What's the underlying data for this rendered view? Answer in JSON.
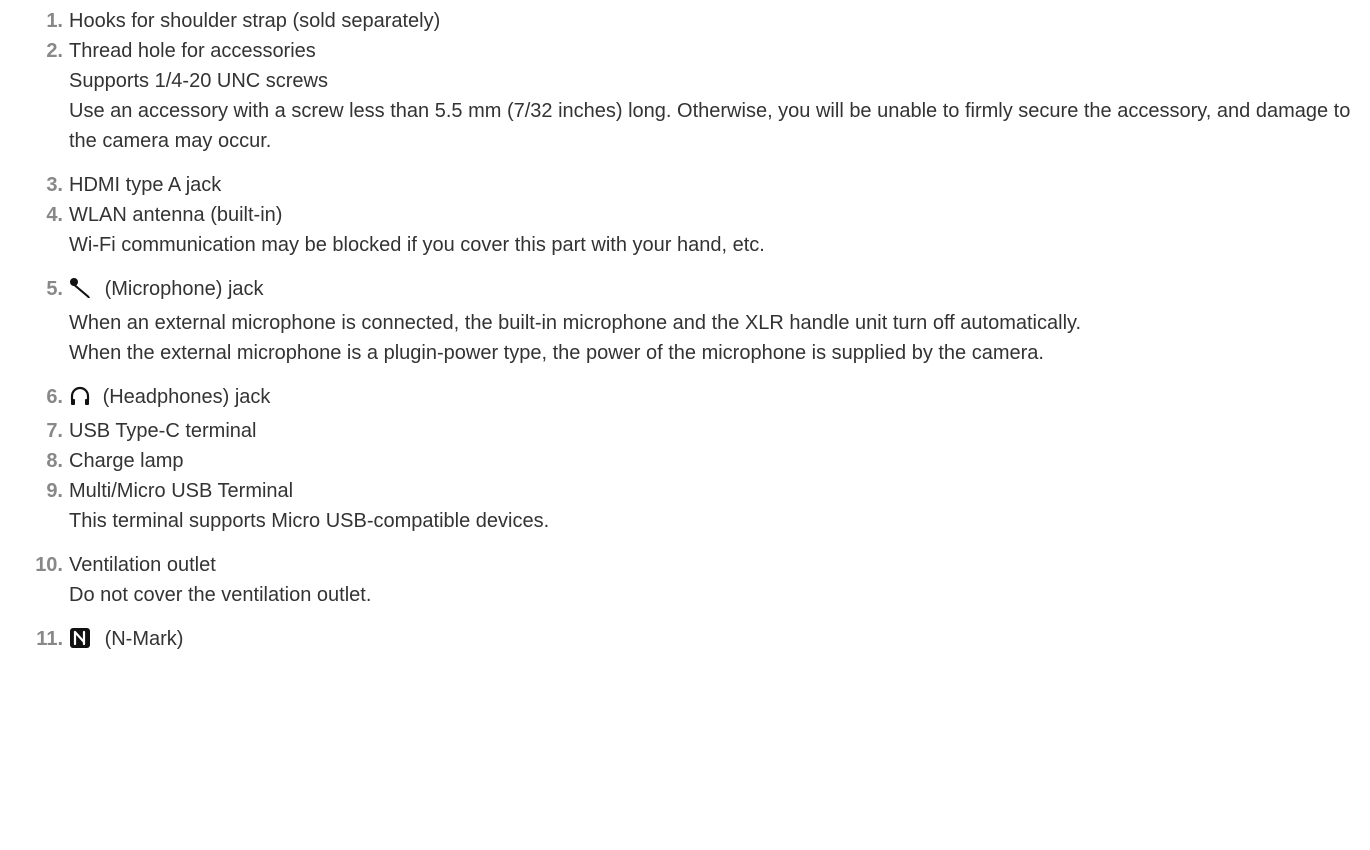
{
  "parts": [
    {
      "number": "1.",
      "label": "Hooks for shoulder strap (sold separately)",
      "descriptions": []
    },
    {
      "number": "2.",
      "label": "Thread hole for accessories",
      "descriptions": [
        "Supports 1/4-20 UNC screws",
        "Use an accessory with a screw less than 5.5 mm (7/32 inches) long. Otherwise, you will be unable to firmly secure the accessory, and damage to the camera may occur."
      ]
    },
    {
      "number": "3.",
      "label": "HDMI type A jack",
      "descriptions": []
    },
    {
      "number": "4.",
      "label": "WLAN antenna (built-in)",
      "descriptions": [
        "Wi-Fi communication may be blocked if you cover this part with your hand, etc."
      ]
    },
    {
      "number": "5.",
      "icon": "microphone-icon",
      "label": "(Microphone) jack",
      "descriptions": [
        "When an external microphone is connected, the built-in microphone and the XLR handle unit turn off automatically.",
        "When the external microphone is a plugin-power type, the power of the microphone is supplied by the camera."
      ]
    },
    {
      "number": "6.",
      "icon": "headphones-icon",
      "label": "(Headphones) jack",
      "descriptions": []
    },
    {
      "number": "7.",
      "label": "USB Type-C terminal",
      "descriptions": []
    },
    {
      "number": "8.",
      "label": "Charge lamp",
      "descriptions": []
    },
    {
      "number": "9.",
      "label": "Multi/Micro USB Terminal",
      "descriptions": [
        "This terminal supports Micro USB-compatible devices."
      ]
    },
    {
      "number": "10.",
      "label": "Ventilation outlet",
      "descriptions": [
        "Do not cover the ventilation outlet."
      ]
    },
    {
      "number": "11.",
      "icon": "n-mark-icon",
      "label": "(N-Mark)",
      "descriptions": []
    }
  ]
}
